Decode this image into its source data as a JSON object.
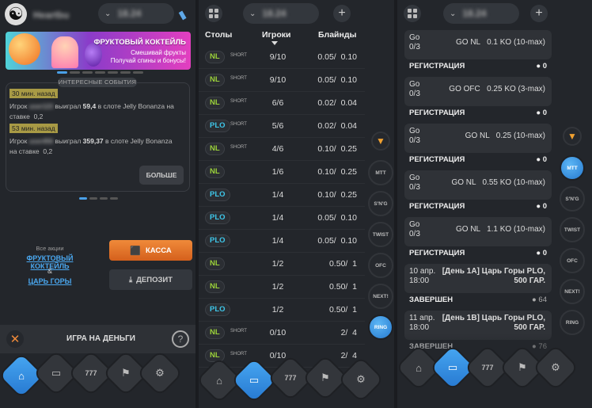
{
  "panel1": {
    "user_blur": "Heartbu",
    "balance_blur": "18.24",
    "banner": {
      "title": "ФРУКТОВЫЙ КОКТЕЙЛЬ",
      "line1": "Смешивай фрукты",
      "line2": "Получай спины и бонусы!"
    },
    "events_label": "ИНТЕРЕСНЫЕ СОБЫТИЯ",
    "events": [
      {
        "time": "30 мин. назад",
        "prefix": "Игрок",
        "name_blur": "user123",
        "mid": "выиграл",
        "amount": "59,4",
        "slot": "в слоте Jelly Bonanza на",
        "bet_label": "ставке",
        "bet": "0,2"
      },
      {
        "time": "53 мин. назад",
        "prefix": "Игрок",
        "name_blur": "user456",
        "mid": "выиграл",
        "amount": "359,37",
        "slot": "в слоте Jelly Bonanza",
        "bet_label": "на ставке",
        "bet": "0,2"
      }
    ],
    "more_label": "БОЛЬШЕ",
    "promo_sub": "Все акции",
    "promo_link1": "ФРУКТОВЫЙ КОКТЕЙЛЬ",
    "promo_amp": "&",
    "promo_link2": "ЦАРЬ ГОРЫ",
    "kassa_label": "КАССА",
    "deposit_label": "ДЕПОЗИТ",
    "money_label": "ИГРА НА ДЕНЬГИ"
  },
  "panel2": {
    "balance_blur": "18.24",
    "headers": {
      "tables": "Столы",
      "players": "Игроки",
      "blinds": "Блайнды"
    },
    "rows": [
      {
        "game": "NL",
        "short": "SHORT",
        "players": "9/10",
        "blinds": "0.05/  0.10"
      },
      {
        "game": "NL",
        "short": "SHORT",
        "players": "9/10",
        "blinds": "0.05/  0.10"
      },
      {
        "game": "NL",
        "short": "SHORT",
        "players": "6/6",
        "blinds": "0.02/  0.04"
      },
      {
        "game": "PLO",
        "short": "SHORT",
        "players": "5/6",
        "blinds": "0.02/  0.04"
      },
      {
        "game": "NL",
        "short": "SHORT",
        "players": "4/6",
        "blinds": "0.10/  0.25"
      },
      {
        "game": "NL",
        "short": "",
        "players": "1/6",
        "blinds": "0.10/  0.25"
      },
      {
        "game": "PLO",
        "short": "",
        "players": "1/4",
        "blinds": "0.10/  0.25"
      },
      {
        "game": "PLO",
        "short": "",
        "players": "1/4",
        "blinds": "0.05/  0.10"
      },
      {
        "game": "PLO",
        "short": "",
        "players": "1/4",
        "blinds": "0.05/  0.10"
      },
      {
        "game": "NL",
        "short": "",
        "players": "1/2",
        "blinds": "0.50/  1"
      },
      {
        "game": "NL",
        "short": "",
        "players": "1/2",
        "blinds": "0.50/  1"
      },
      {
        "game": "PLO",
        "short": "",
        "players": "1/2",
        "blinds": "0.50/  1"
      },
      {
        "game": "NL",
        "short": "SHORT",
        "players": "0/10",
        "blinds": "2/  4"
      },
      {
        "game": "NL",
        "short": "SHORT",
        "players": "0/10",
        "blinds": "2/  4"
      }
    ],
    "side": [
      "MTT",
      "S'N'G",
      "TWIST",
      "OFC",
      "NEXT!",
      "RING"
    ],
    "side_active": "RING"
  },
  "panel3": {
    "balance_blur": "18.24",
    "tournaments": [
      {
        "game": "Go",
        "count": "0/3",
        "name": "GO NL   0.1 KO (10-max)",
        "status": "РЕГИСТРАЦИЯ",
        "players": "0"
      },
      {
        "game": "Go",
        "count": "0/3",
        "name": "GO OFC   0.25 KO (3-max)",
        "status": "РЕГИСТРАЦИЯ",
        "players": "0"
      },
      {
        "game": "Go",
        "count": "0/3",
        "name": "GO NL   0.25 (10-max)",
        "status": "РЕГИСТРАЦИЯ",
        "players": "0"
      },
      {
        "game": "Go",
        "count": "0/3",
        "name": "GO NL   0.55 KO (10-max)",
        "status": "РЕГИСТРАЦИЯ",
        "players": "0"
      },
      {
        "game": "Go",
        "count": "0/3",
        "name": "GO NL   1.1 KO (10-max)",
        "status": "РЕГИСТРАЦИЯ",
        "players": "0"
      },
      {
        "game": "10 апр.",
        "count": "18:00",
        "name": "[День 1A] Царь Горы PLO,\n500 ГАР.",
        "status": "ЗАВЕРШЕН",
        "players": "64"
      },
      {
        "game": "11 апр.",
        "count": "18:00",
        "name": "[День 1B] Царь Горы PLO,\n500 ГАР.",
        "status": "ЗАВЕРШЕН",
        "players": "76"
      }
    ],
    "side": [
      "MTT",
      "S'N'G",
      "TWIST",
      "OFC",
      "NEXT!",
      "RING"
    ],
    "side_active": "MTT"
  },
  "nav": {
    "slots_label": "777"
  },
  "colors": {
    "accent_blue": "#3a95e6",
    "orange": "#e8772a",
    "nl_green": "#9bd23a",
    "plo_cyan": "#3ec7ea"
  }
}
